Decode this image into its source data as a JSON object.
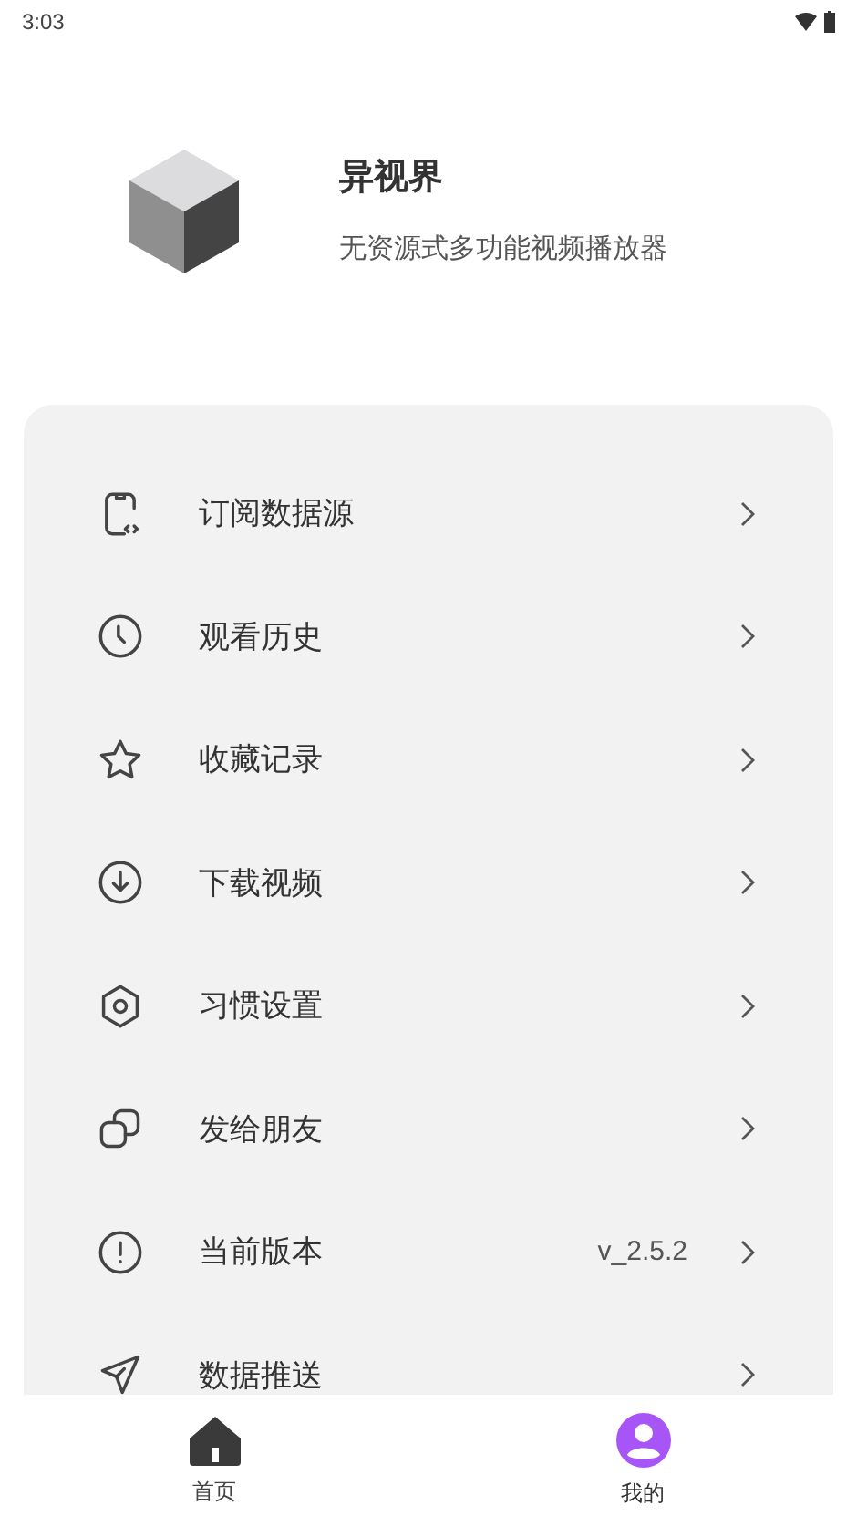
{
  "status_bar": {
    "time": "3:03"
  },
  "profile": {
    "name": "异视界",
    "tagline": "无资源式多功能视频播放器"
  },
  "menu": [
    {
      "kind": "subscribe",
      "label": "订阅数据源"
    },
    {
      "kind": "history",
      "label": "观看历史"
    },
    {
      "kind": "favorite",
      "label": "收藏记录"
    },
    {
      "kind": "download",
      "label": "下载视频"
    },
    {
      "kind": "settings",
      "label": "习惯设置"
    },
    {
      "kind": "share",
      "label": "发给朋友"
    },
    {
      "kind": "version",
      "label": "当前版本",
      "value": "v_2.5.2"
    },
    {
      "kind": "push",
      "label": "数据推送"
    }
  ],
  "bottom_nav": [
    {
      "kind": "home",
      "label": "首页",
      "selected": false
    },
    {
      "kind": "profile",
      "label": "我的",
      "selected": true
    }
  ]
}
